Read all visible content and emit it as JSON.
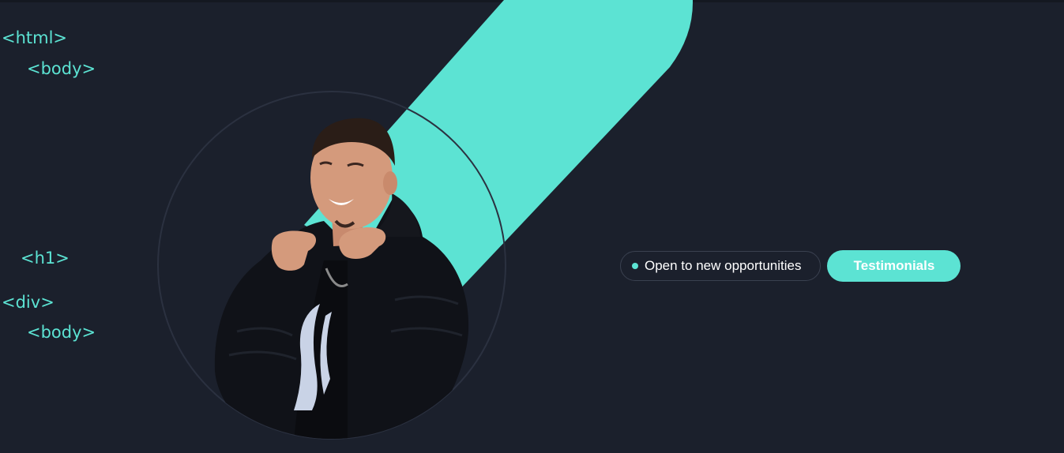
{
  "code_tags": {
    "html_open": "<html>",
    "body_open": "<body>",
    "h1": "<h1>",
    "div": "<div>",
    "body_close": "<body>"
  },
  "hero": {
    "status_text": "Open to new opportunities",
    "testimonials_label": "Testimonials"
  },
  "colors": {
    "background": "#1b202c",
    "accent": "#5ce3d3",
    "text": "#ffffff",
    "pill_border": "#3a4150"
  },
  "icons": [
    "status-dot-icon"
  ]
}
